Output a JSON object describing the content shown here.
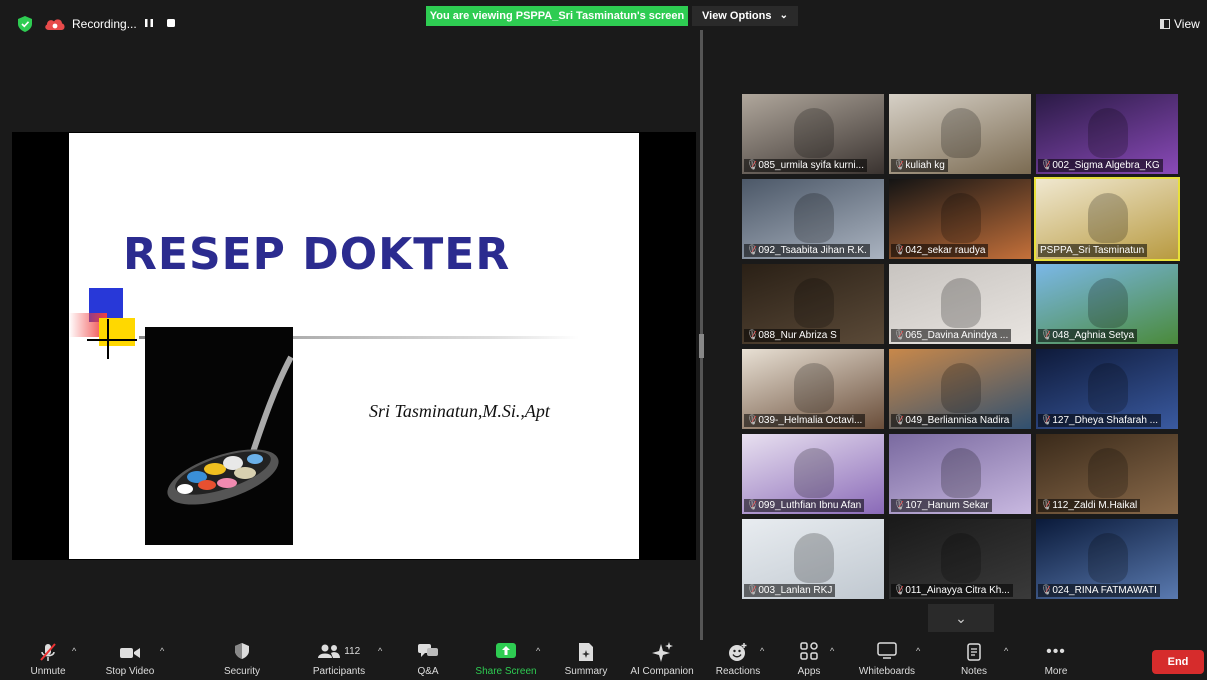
{
  "topbar": {
    "recording_label": "Recording...",
    "viewing_banner": "You are viewing PSPPA_Sri Tasminatun's screen",
    "view_options": "View Options",
    "view_label": "View"
  },
  "slide": {
    "title": "RESEP DOKTER",
    "author": "Sri Tasminatun,M.Si.,Apt"
  },
  "gallery": {
    "tiles": [
      {
        "name": "085_urmila syifa kurni...",
        "muted": true
      },
      {
        "name": "kuliah kg",
        "muted": true
      },
      {
        "name": "002_Sigma Algebra_KG",
        "muted": true
      },
      {
        "name": "092_Tsaabita Jihan R.K.",
        "muted": true
      },
      {
        "name": "042_sekar raudya",
        "muted": true
      },
      {
        "name": "PSPPA_Sri Tasminatun",
        "muted": false,
        "active": true
      },
      {
        "name": "088_Nur Abriza S",
        "muted": true
      },
      {
        "name": "065_Davina Anindya ...",
        "muted": true
      },
      {
        "name": "048_Aghnia Setya",
        "muted": true
      },
      {
        "name": "039-_Helmalia Octavi...",
        "muted": true
      },
      {
        "name": "049_Berliannisa Nadira",
        "muted": true
      },
      {
        "name": "127_Dheya Shafarah ...",
        "muted": true
      },
      {
        "name": "099_Luthfian Ibnu Afan",
        "muted": true
      },
      {
        "name": "107_Hanum Sekar",
        "muted": true
      },
      {
        "name": "112_Zaldi M.Haikal",
        "muted": true
      },
      {
        "name": "003_Lanlan RKJ",
        "muted": true
      },
      {
        "name": "011_Ainayya Citra Kh...",
        "muted": true
      },
      {
        "name": "024_RINA FATMAWATI",
        "muted": true
      }
    ]
  },
  "toolbar": {
    "unmute": "Unmute",
    "stop_video": "Stop Video",
    "security": "Security",
    "participants": "Participants",
    "participants_count": "112",
    "qa": "Q&A",
    "share_screen": "Share Screen",
    "summary": "Summary",
    "ai_companion": "AI Companion",
    "reactions": "Reactions",
    "apps": "Apps",
    "whiteboards": "Whiteboards",
    "notes": "Notes",
    "more": "More",
    "end": "End"
  },
  "colors": {
    "banner_green": "#2ecc52",
    "end_red": "#d62c2c",
    "active_tile": "#e8e03a",
    "slide_title": "#2b2b8f"
  }
}
